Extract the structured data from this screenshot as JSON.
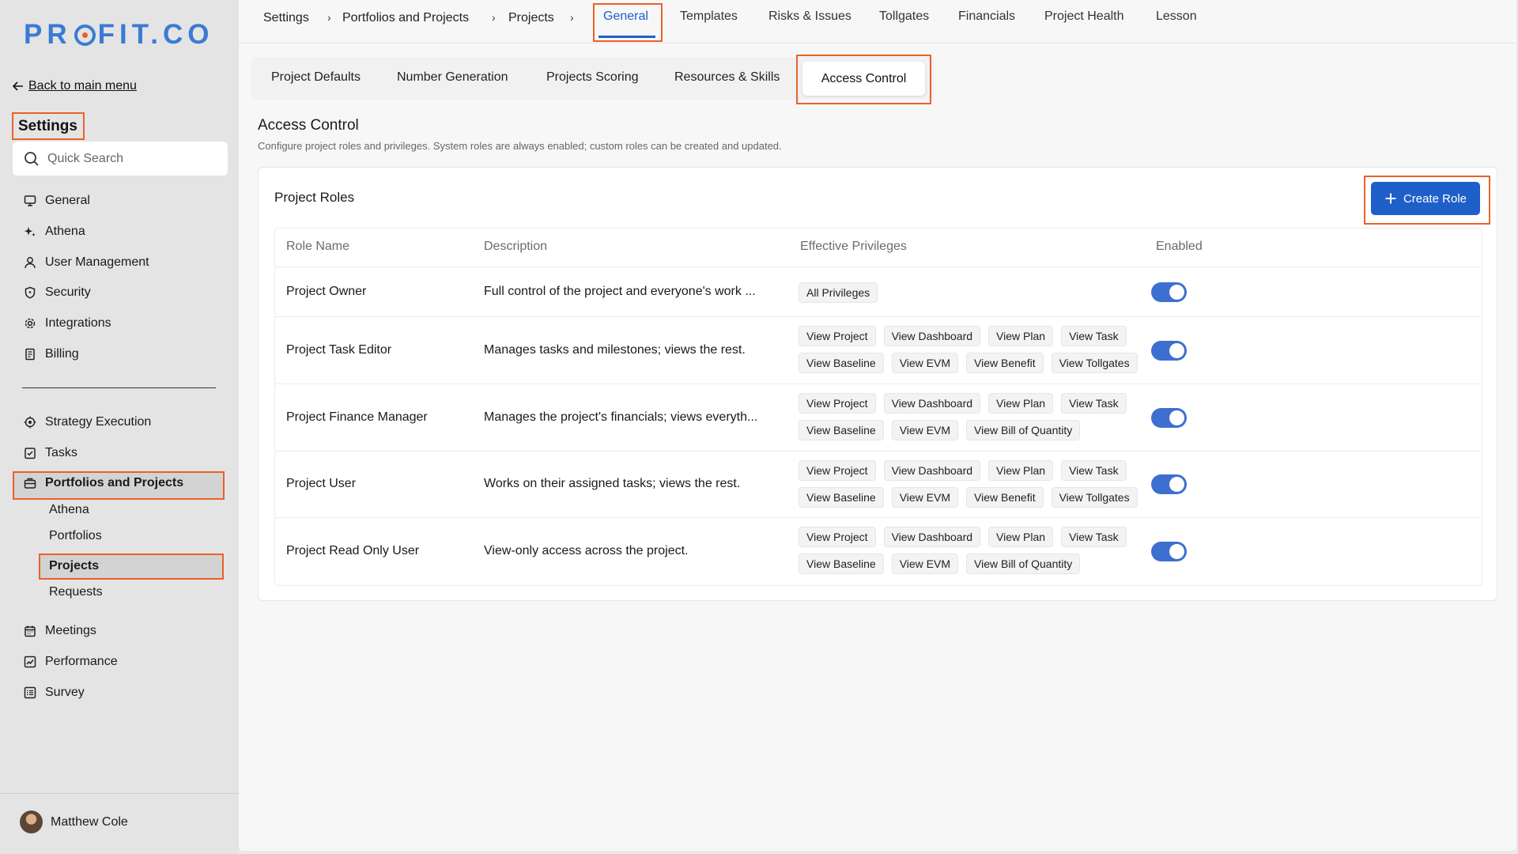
{
  "brand": {
    "logo_pre": "PR",
    "logo_post": "FIT.CO"
  },
  "sidebar": {
    "back_link": "Back to main menu",
    "title": "Settings",
    "search_placeholder": "Quick Search",
    "items_top": [
      {
        "label": "General",
        "icon": "monitor-icon"
      },
      {
        "label": "Athena",
        "icon": "sparkle-icon"
      },
      {
        "label": "User Management",
        "icon": "user-icon"
      },
      {
        "label": "Security",
        "icon": "shield-icon"
      },
      {
        "label": "Integrations",
        "icon": "gear-icon"
      },
      {
        "label": "Billing",
        "icon": "receipt-icon"
      }
    ],
    "items_mid": [
      {
        "label": "Strategy Execution",
        "icon": "target-icon"
      },
      {
        "label": "Tasks",
        "icon": "checkbox-icon"
      },
      {
        "label": "Portfolios and Projects",
        "icon": "briefcase-icon"
      }
    ],
    "sub_items": [
      "Athena",
      "Portfolios",
      "Projects",
      "Requests"
    ],
    "items_bottom": [
      {
        "label": "Meetings",
        "icon": "calendar-icon"
      },
      {
        "label": "Performance",
        "icon": "chart-icon"
      },
      {
        "label": "Survey",
        "icon": "list-icon"
      }
    ],
    "user_name": "Matthew Cole"
  },
  "breadcrumb": [
    "Settings",
    "Portfolios and Projects",
    "Projects"
  ],
  "top_tabs": [
    "General",
    "Templates",
    "Risks & Issues",
    "Tollgates",
    "Financials",
    "Project Health",
    "Lesson"
  ],
  "active_top_tab": "General",
  "sub_tabs": [
    "Project Defaults",
    "Number Generation",
    "Projects Scoring",
    "Resources & Skills",
    "Access Control"
  ],
  "active_sub_tab": "Access Control",
  "page": {
    "title": "Access Control",
    "description": "Configure project roles and privileges. System roles are always enabled; custom roles can be created and updated."
  },
  "card": {
    "title": "Project Roles",
    "create_button": "Create Role",
    "columns": [
      "Role Name",
      "Description",
      "Effective Privileges",
      "Enabled"
    ],
    "rows": [
      {
        "name": "Project Owner",
        "description": "Full control of the project and everyone's work ...",
        "privileges": [
          "All Privileges"
        ],
        "enabled": true
      },
      {
        "name": "Project Task Editor",
        "description": "Manages tasks and milestones; views the rest.",
        "privileges": [
          "View Project",
          "View Dashboard",
          "View Plan",
          "View Task",
          "View Baseline",
          "View EVM",
          "View Benefit",
          "View Tollgates"
        ],
        "enabled": true
      },
      {
        "name": "Project Finance Manager",
        "description": "Manages the project's financials; views everyth...",
        "privileges": [
          "View Project",
          "View Dashboard",
          "View Plan",
          "View Task",
          "View Baseline",
          "View EVM",
          "View Bill of Quantity"
        ],
        "enabled": true
      },
      {
        "name": "Project User",
        "description": "Works on their assigned tasks; views the rest.",
        "privileges": [
          "View Project",
          "View Dashboard",
          "View Plan",
          "View Task",
          "View Baseline",
          "View EVM",
          "View Benefit",
          "View Tollgates"
        ],
        "enabled": true
      },
      {
        "name": "Project Read Only User",
        "description": "View-only access across the project.",
        "privileges": [
          "View Project",
          "View Dashboard",
          "View Plan",
          "View Task",
          "View Baseline",
          "View EVM",
          "View Bill of Quantity"
        ],
        "enabled": true
      }
    ]
  },
  "colors": {
    "accent": "#1f5fc9",
    "highlight": "#e8622a",
    "brand": "#3a7bd5"
  }
}
